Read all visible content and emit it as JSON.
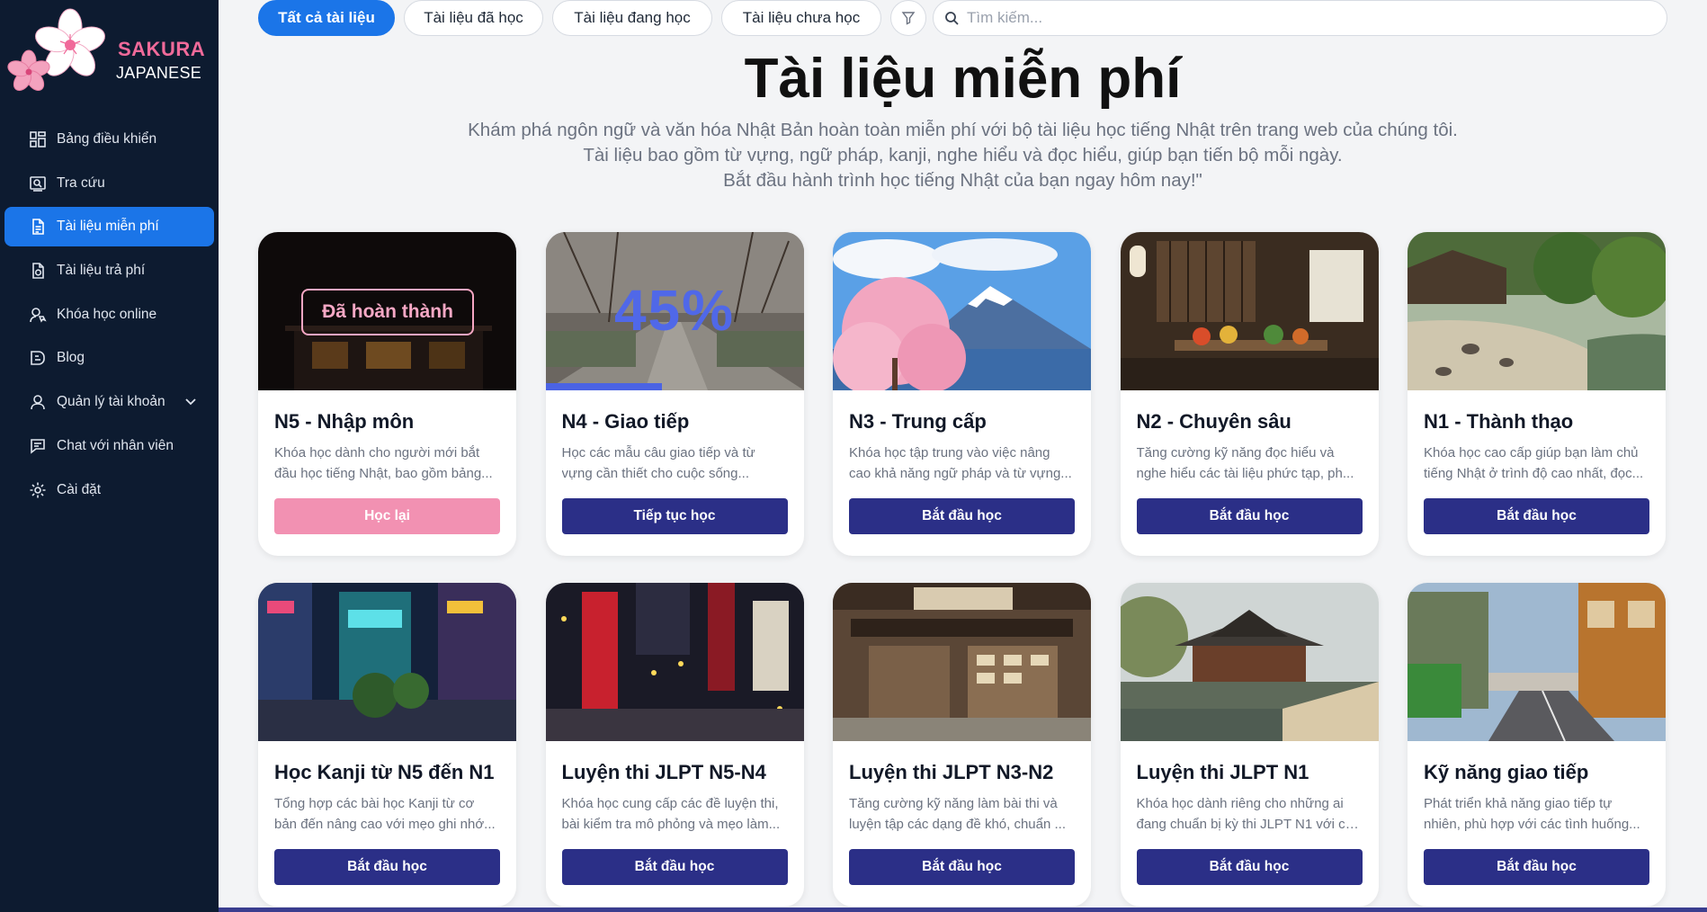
{
  "brand": {
    "name": "SAKURA",
    "sub": "JAPANESE"
  },
  "sidebar": {
    "items": [
      {
        "label": "Bảng điều khiển",
        "icon": "dashboard-icon"
      },
      {
        "label": "Tra cứu",
        "icon": "lookup-icon"
      },
      {
        "label": "Tài liệu miễn phí",
        "icon": "document-icon",
        "active": true
      },
      {
        "label": "Tài liệu trả phí",
        "icon": "paid-document-icon"
      },
      {
        "label": "Khóa học online",
        "icon": "course-icon"
      },
      {
        "label": "Blog",
        "icon": "blog-icon"
      },
      {
        "label": "Quản lý tài khoản",
        "icon": "user-icon",
        "expandable": true
      },
      {
        "label": "Chat với nhân viên",
        "icon": "chat-icon"
      },
      {
        "label": "Cài đặt",
        "icon": "gear-icon"
      }
    ]
  },
  "filters": {
    "all": "Tất cả tài liệu",
    "learned": "Tài liệu đã học",
    "learning": "Tài liệu đang học",
    "not_learned": "Tài liệu chưa học",
    "search_placeholder": "Tìm kiếm..."
  },
  "page": {
    "title": "Tài liệu miễn phí",
    "desc1": "Khám phá ngôn ngữ và văn hóa Nhật Bản hoàn toàn miễn phí với bộ tài liệu học tiếng Nhật trên trang web của chúng tôi.",
    "desc2": "Tài liệu bao gồm từ vựng, ngữ pháp, kanji, nghe hiểu và đọc hiểu, giúp bạn tiến bộ mỗi ngày.",
    "desc3": "Bắt đầu hành trình học tiếng Nhật của bạn ngay hôm nay!\""
  },
  "cards": [
    {
      "title": "N5 - Nhập môn",
      "d1": "Khóa học dành cho người mới bắt",
      "d2": "đầu học tiếng Nhật, bao gồm bảng...",
      "button": "Học lại",
      "badge": "Đã hoàn thành"
    },
    {
      "title": "N4 - Giao tiếp",
      "d1": "Học các mẫu câu giao tiếp và từ",
      "d2": "vựng cần thiết cho cuộc sống...",
      "button": "Tiếp tục học",
      "progress_label": "45%",
      "progress": 0.45
    },
    {
      "title": "N3 - Trung cấp",
      "d1": "Khóa học tập trung vào việc nâng",
      "d2": "cao khả năng ngữ pháp và từ vựng...",
      "button": "Bắt đầu học"
    },
    {
      "title": "N2 - Chuyên sâu",
      "d1": "Tăng cường kỹ năng đọc hiểu và",
      "d2": "nghe hiểu các tài liệu phức tạp, ph...",
      "button": "Bắt đầu học"
    },
    {
      "title": "N1 - Thành thạo",
      "d1": "Khóa học cao cấp giúp bạn làm chủ",
      "d2": "tiếng Nhật ở trình độ cao nhất, đọc...",
      "button": "Bắt đầu học"
    },
    {
      "title": "Học Kanji từ N5 đến N1",
      "d1": "Tổng hợp các bài học Kanji từ cơ",
      "d2": "bản đến nâng cao với mẹo ghi nhớ...",
      "button": "Bắt đầu học"
    },
    {
      "title": "Luyện thi JLPT N5-N4",
      "d1": "Khóa học cung cấp các đề luyện thi,",
      "d2": "bài kiểm tra mô phỏng và mẹo làm...",
      "button": "Bắt đầu học"
    },
    {
      "title": "Luyện thi JLPT N3-N2",
      "d1": "Tăng cường kỹ năng làm bài thi và",
      "d2": "luyện tập các dạng đề khó, chuẩn ...",
      "button": "Bắt đầu học"
    },
    {
      "title": "Luyện thi JLPT N1",
      "d1": "Khóa học dành riêng cho những ai",
      "d2": "đang chuẩn bị kỳ thi JLPT N1 với cá...",
      "button": "Bắt đầu học"
    },
    {
      "title": "Kỹ năng giao tiếp",
      "d1": "Phát triển khả năng giao tiếp tự",
      "d2": "nhiên, phù hợp với các tình huống...",
      "button": "Bắt đầu học"
    }
  ],
  "colors": {
    "primary": "#1b75e8",
    "sidebar": "#0d1b30",
    "card_button": "#2b2f87",
    "retake_button": "#f291b2",
    "brand_pink": "#f06a9a"
  }
}
